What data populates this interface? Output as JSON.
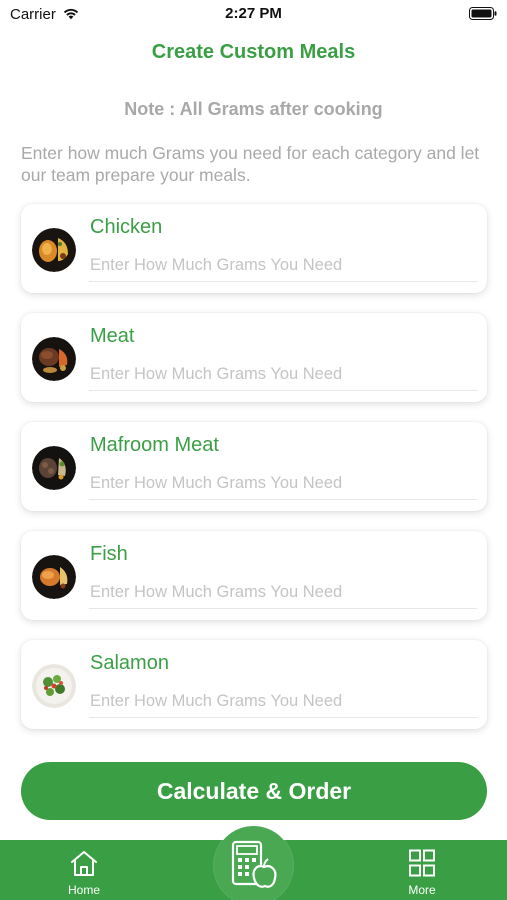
{
  "status_bar": {
    "carrier": "Carrier",
    "time": "2:27 PM"
  },
  "header": {
    "title": "Create Custom Meals"
  },
  "note": "Note : All Grams after cooking",
  "intro": "Enter how much Grams you need for each category and let our team prepare your meals.",
  "categories": [
    {
      "name": "Chicken",
      "placeholder": "Enter How Much Grams You Need",
      "value": ""
    },
    {
      "name": "Meat",
      "placeholder": "Enter How Much Grams You Need",
      "value": ""
    },
    {
      "name": "Mafroom Meat",
      "placeholder": "Enter How Much Grams You Need",
      "value": ""
    },
    {
      "name": "Fish",
      "placeholder": "Enter How Much Grams You Need",
      "value": ""
    },
    {
      "name": "Salamon",
      "placeholder": "Enter How Much Grams You Need",
      "value": ""
    }
  ],
  "cta_label": "Calculate & Order",
  "tabbar": {
    "home_label": "Home",
    "more_label": "More",
    "center_icon": "calculator-apple-icon"
  },
  "colors": {
    "accent": "#3a9f44",
    "muted_text": "#a9a9a9",
    "placeholder": "#c4c4c4"
  }
}
